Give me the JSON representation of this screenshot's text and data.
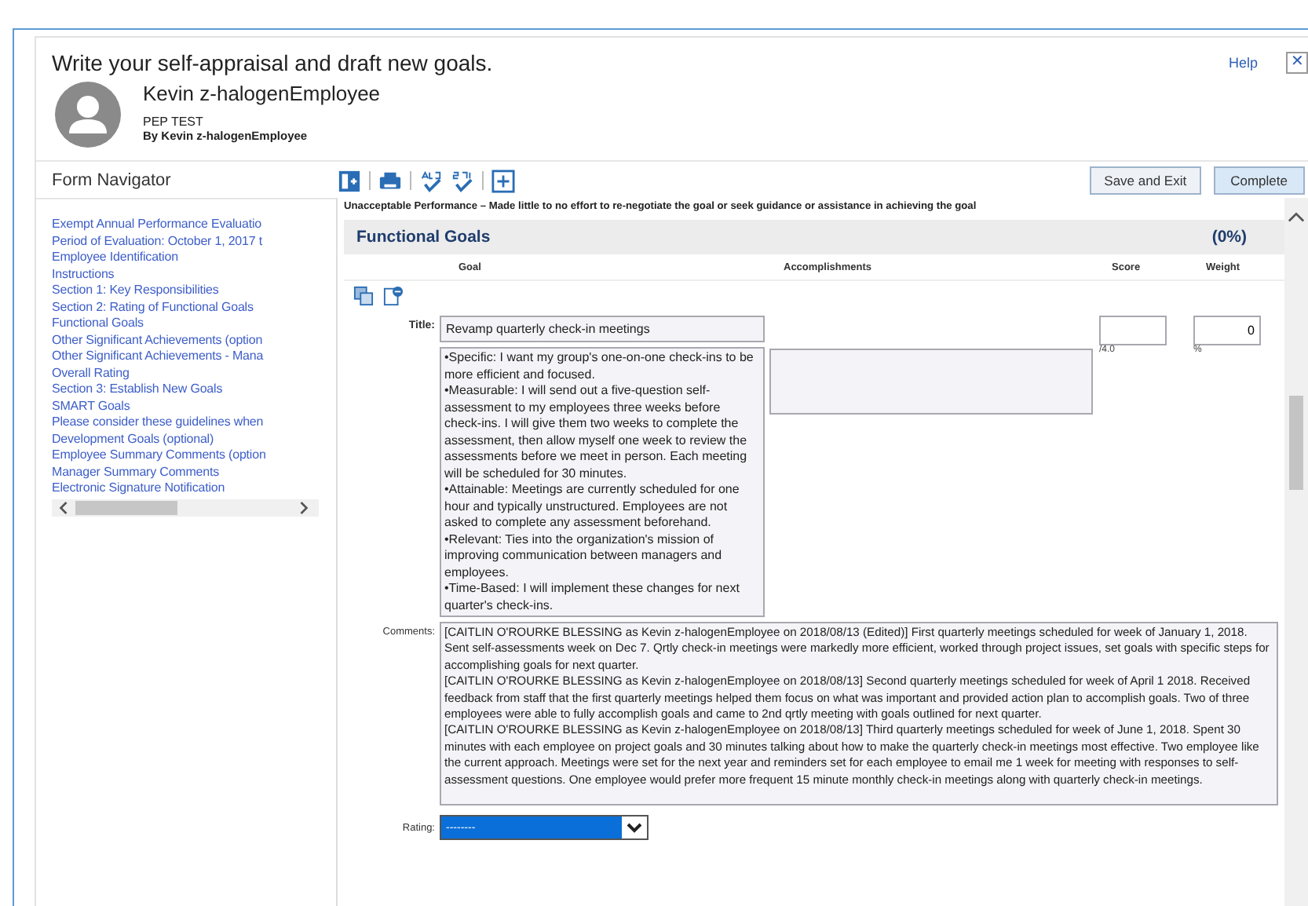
{
  "dialog": {
    "title": "Write your self-appraisal and draft new goals.",
    "help": "Help",
    "close": "✕"
  },
  "person": {
    "name": "Kevin z-halogenEmployee",
    "form": "PEP TEST",
    "by": "By Kevin z-halogenEmployee"
  },
  "navigator": {
    "title": "Form Navigator",
    "items": [
      "Exempt Annual Performance Evaluatio",
      "Period of Evaluation: October 1, 2017 t",
      "Employee Identification",
      "Instructions",
      "Section 1: Key Responsibilities",
      "Section 2: Rating of Functional Goals",
      "Functional Goals",
      "Other Significant Achievements (option",
      "Other Significant Achievements - Mana",
      "Overall Rating",
      "Section 3: Establish New Goals",
      "SMART Goals",
      "Please consider these guidelines when",
      "Development Goals (optional)",
      "Employee Summary Comments (option",
      "Manager Summary Comments",
      "Electronic Signature Notification"
    ]
  },
  "buttons": [
    "Save and Exit",
    "Complete"
  ],
  "criteria": "Unacceptable Performance – Made little to no effort to re-negotiate the goal or seek guidance or assistance in achieving the goal",
  "section": {
    "title": "Functional Goals",
    "percent": "(0%)",
    "columns": [
      "Goal",
      "Accomplishments",
      "Score",
      "Weight"
    ]
  },
  "goal": {
    "title_label": "Title:",
    "title": "Revamp quarterly check-in meetings",
    "description": [
      "•Specific: I want my group's one-on-one check-ins to be more efficient and focused.",
      "•Measurable: I will send out a five-question self-assessment to my employees three weeks before check-ins. I will give them two weeks to complete the assessment, then allow myself one week to review the assessments before we meet in person. Each meeting will be scheduled for 30 minutes.",
      "•Attainable: Meetings are currently scheduled for one hour and typically unstructured. Employees are not asked to complete any assessment beforehand.",
      "•Relevant: Ties into the organization's mission of improving communication between managers and employees.",
      "•Time-Based: I will implement these changes for next quarter's check-ins."
    ],
    "score_suffix": "/4.0",
    "weight": "0",
    "weight_suffix": "%"
  },
  "comments": {
    "label": "Comments:",
    "paragraphs": [
      "[CAITLIN O'ROURKE BLESSING as Kevin z-halogenEmployee on 2018/08/13 (Edited)] First quarterly meetings scheduled for week of January 1, 2018.  Sent self-assessments week on Dec 7.  Qrtly check-in meetings were markedly more efficient, worked through project issues, set goals with specific steps for accomplishing goals for next quarter.",
      "[CAITLIN O'ROURKE BLESSING as Kevin z-halogenEmployee on 2018/08/13] Second quarterly meetings scheduled for week of April 1 2018.  Received feedback from staff that the first quarterly meetings helped them focus on what was important and provided action plan to accomplish goals.  Two of three employees were able to fully accomplish goals and came to 2nd qrtly meeting with goals outlined for next quarter.",
      "[CAITLIN O'ROURKE BLESSING as Kevin z-halogenEmployee on 2018/08/13] Third quarterly meetings scheduled for week of June 1, 2018.  Spent 30 minutes with each employee on project goals and 30 minutes talking about how to make the quarterly check-in meetings most effective.  Two employee like the current approach. Meetings were set for the next year and reminders set for each employee to email me 1 week for meeting with responses to self-assessment questions.  One employee would prefer more frequent 15 minute monthly check-in meetings along with quarterly check-in meetings."
    ]
  },
  "rating": {
    "label": "Rating:",
    "value": "--------"
  }
}
